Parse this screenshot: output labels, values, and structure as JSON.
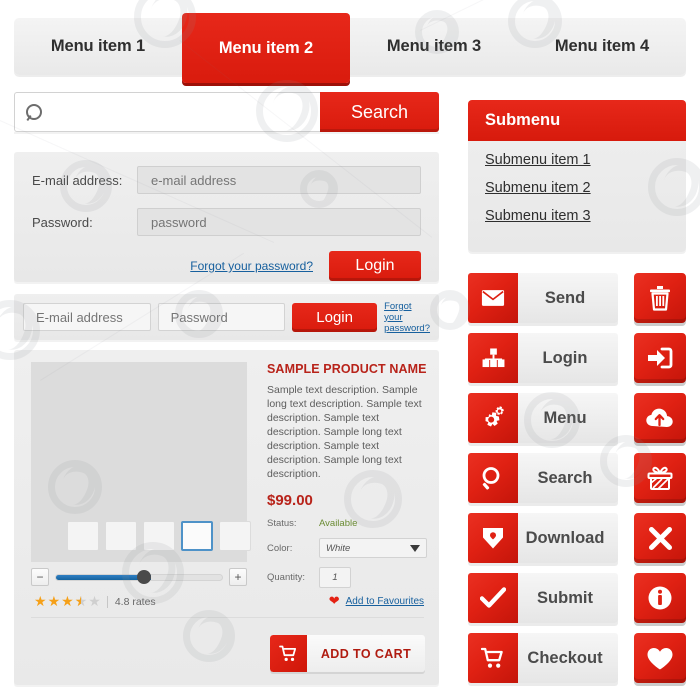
{
  "colors": {
    "accent_red": "#E02113",
    "accent_red_dark": "#C4150A",
    "link_blue": "#17609E",
    "panel_gray": "#EFEFEF",
    "star_orange": "#F5A018",
    "available_green": "#6B8C34",
    "slider_blue": "#15649F"
  },
  "tabs": [
    {
      "label": "Menu item 1",
      "active": false
    },
    {
      "label": "Menu item 2",
      "active": true
    },
    {
      "label": "Menu item 3",
      "active": false
    },
    {
      "label": "Menu item 4",
      "active": false
    }
  ],
  "search": {
    "icon": "search-icon",
    "placeholder": "",
    "value": "",
    "button_label": "Search"
  },
  "login_panel": {
    "email_label": "E-mail address:",
    "email_placeholder": "e-mail address",
    "email_value": "",
    "password_label": "Password:",
    "password_placeholder": "password",
    "password_value": "",
    "forgot_link": "Forgot your password?",
    "login_button": "Login"
  },
  "inline_login": {
    "email_placeholder": "E-mail address",
    "email_value": "",
    "password_placeholder": "Password",
    "password_value": "",
    "login_button": "Login",
    "forgot_link": "Forgot your password?"
  },
  "product": {
    "name": "SAMPLE PRODUCT NAME",
    "description": "Sample text description. Sample long text description. Sample text description. Sample text description. Sample long text description. Sample text description. Sample long text description.",
    "price": "$99.00",
    "status_label": "Status:",
    "status_value": "Available",
    "color_label": "Color:",
    "color_value": "White",
    "color_options": [
      "White"
    ],
    "quantity_label": "Quantity:",
    "quantity_value": "1",
    "thumbnails": [
      {
        "selected": false
      },
      {
        "selected": false
      },
      {
        "selected": false
      },
      {
        "selected": true
      },
      {
        "selected": false
      }
    ],
    "slider": {
      "minus_label": "−",
      "plus_label": "+",
      "fill_percent": 57
    },
    "rating": {
      "stars": [
        "full",
        "full",
        "full",
        "half",
        "empty"
      ],
      "text": "4.8 rates"
    },
    "favourites": {
      "icon": "heart-icon",
      "label": "Add to Favourites"
    },
    "add_to_cart": {
      "icon": "cart-icon",
      "label": "ADD TO CART"
    }
  },
  "submenu": {
    "title": "Submenu",
    "items": [
      {
        "label": "Submenu item 1"
      },
      {
        "label": "Submenu item 2"
      },
      {
        "label": "Submenu item 3"
      }
    ]
  },
  "wide_buttons": [
    {
      "label": "Send",
      "icon": "envelope-icon"
    },
    {
      "label": "Login",
      "icon": "login-user-icon"
    },
    {
      "label": "Menu",
      "icon": "gears-icon"
    },
    {
      "label": "Search",
      "icon": "magnifier-icon"
    },
    {
      "label": "Download",
      "icon": "download-icon"
    },
    {
      "label": "Submit",
      "icon": "checkmark-icon"
    },
    {
      "label": "Checkout",
      "icon": "shopping-cart-icon"
    }
  ],
  "square_buttons": [
    {
      "icon": "trash-icon"
    },
    {
      "icon": "login-arrow-icon"
    },
    {
      "icon": "cloud-upload-icon"
    },
    {
      "icon": "gift-icon"
    },
    {
      "icon": "close-x-icon"
    },
    {
      "icon": "info-icon"
    },
    {
      "icon": "heart-icon"
    }
  ]
}
